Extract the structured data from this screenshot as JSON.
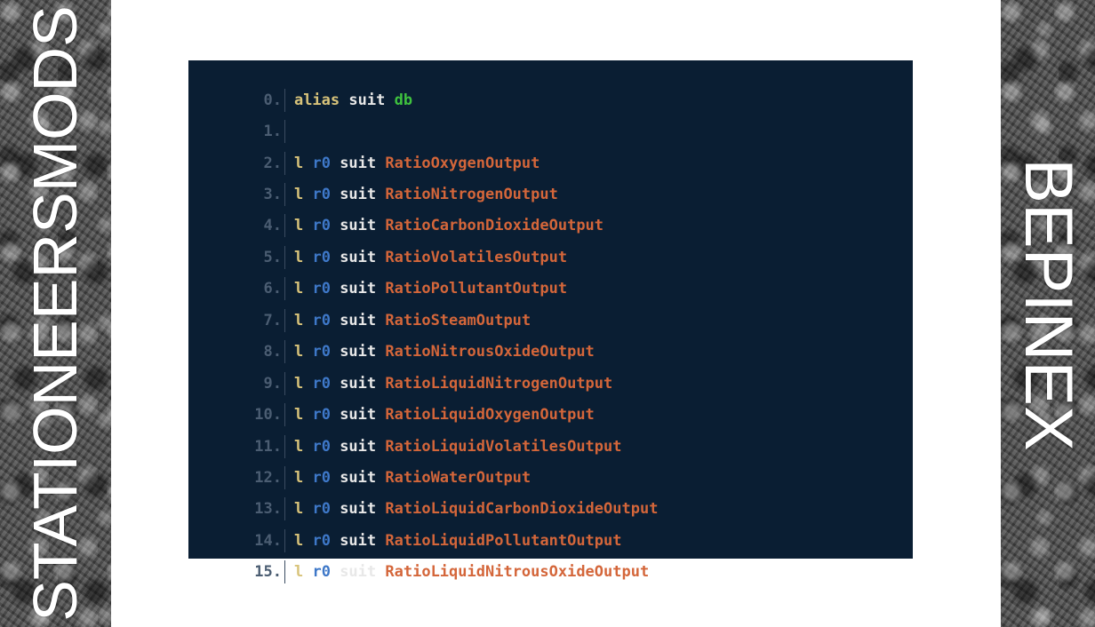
{
  "left_banner": {
    "text": "STATIONEERSMODS"
  },
  "right_banner": {
    "text": "BEPINEX"
  },
  "code": {
    "lines": [
      {
        "num": "0.",
        "kw": "alias",
        "reg": "",
        "dev": "suit",
        "arg": "db",
        "arg_color": "green"
      },
      {
        "num": "1.",
        "kw": "",
        "reg": "",
        "dev": "",
        "arg": ""
      },
      {
        "num": "2.",
        "kw": "l",
        "reg": "r0",
        "dev": "suit",
        "arg": "RatioOxygenOutput"
      },
      {
        "num": "3.",
        "kw": "l",
        "reg": "r0",
        "dev": "suit",
        "arg": "RatioNitrogenOutput"
      },
      {
        "num": "4.",
        "kw": "l",
        "reg": "r0",
        "dev": "suit",
        "arg": "RatioCarbonDioxideOutput"
      },
      {
        "num": "5.",
        "kw": "l",
        "reg": "r0",
        "dev": "suit",
        "arg": "RatioVolatilesOutput"
      },
      {
        "num": "6.",
        "kw": "l",
        "reg": "r0",
        "dev": "suit",
        "arg": "RatioPollutantOutput"
      },
      {
        "num": "7.",
        "kw": "l",
        "reg": "r0",
        "dev": "suit",
        "arg": "RatioSteamOutput"
      },
      {
        "num": "8.",
        "kw": "l",
        "reg": "r0",
        "dev": "suit",
        "arg": "RatioNitrousOxideOutput"
      },
      {
        "num": "9.",
        "kw": "l",
        "reg": "r0",
        "dev": "suit",
        "arg": "RatioLiquidNitrogenOutput"
      },
      {
        "num": "10.",
        "kw": "l",
        "reg": "r0",
        "dev": "suit",
        "arg": "RatioLiquidOxygenOutput"
      },
      {
        "num": "11.",
        "kw": "l",
        "reg": "r0",
        "dev": "suit",
        "arg": "RatioLiquidVolatilesOutput"
      },
      {
        "num": "12.",
        "kw": "l",
        "reg": "r0",
        "dev": "suit",
        "arg": "RatioWaterOutput"
      },
      {
        "num": "13.",
        "kw": "l",
        "reg": "r0",
        "dev": "suit",
        "arg": "RatioLiquidCarbonDioxideOutput"
      },
      {
        "num": "14.",
        "kw": "l",
        "reg": "r0",
        "dev": "suit",
        "arg": "RatioLiquidPollutantOutput"
      },
      {
        "num": "15.",
        "kw": "l",
        "reg": "r0",
        "dev": "suit",
        "arg": "RatioLiquidNitrousOxideOutput"
      }
    ]
  },
  "colors": {
    "panel_bg": "#0a1e33",
    "keyword": "#d8c37a",
    "register": "#3e78c8",
    "device": "#e8e8e8",
    "property": "#d4663a",
    "alias_arg": "#3fc23f",
    "line_number": "#4b5d72"
  }
}
